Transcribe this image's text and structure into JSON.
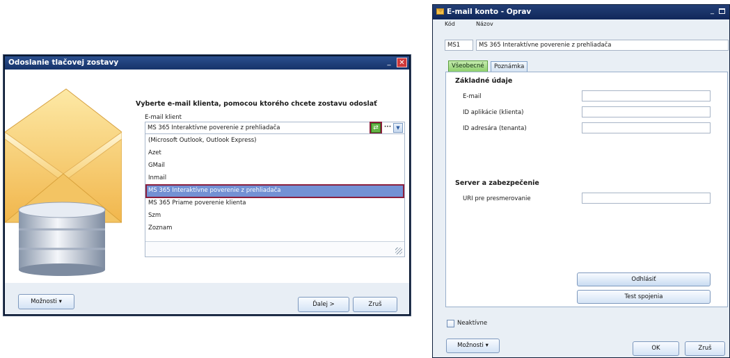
{
  "left_dialog": {
    "title": "Odoslanie tlačovej zostavy",
    "minimize_glyph": "_",
    "close_glyph": "✕",
    "heading": "Vyberte e-mail klienta, pomocou ktorého chcete zostavu odoslať",
    "field_label": "E-mail klient",
    "combo_value": "MS 365 Interaktívne poverenie z prehliadača",
    "combo_green_glyph": "⇄",
    "combo_dots": "···",
    "combo_down_glyph": "▼",
    "options": [
      "(Microsoft Outlook, Outlook Express)",
      "Azet",
      "GMail",
      "Inmail",
      "MS 365 Interaktívne poverenie z prehliadača",
      "MS 365 Priame poverenie klienta",
      "Szm",
      "Zoznam"
    ],
    "selected_option": "MS 365 Interaktívne poverenie z prehliadača",
    "buttons": {
      "moznosti": "Možnosti ▾",
      "dalej": "Ďalej >",
      "zrus": "Zruš"
    },
    "icons": [
      "envelope-icon",
      "database-icon"
    ]
  },
  "right_dialog": {
    "title": "E-mail konto - Oprav",
    "minimize_glyph": "_",
    "kod_label": "Kód",
    "nazov_label": "Názov",
    "kod_value": "MS1",
    "nazov_value": "MS 365 Interaktívne poverenie z prehliadača",
    "tabs": [
      "Všeobecné",
      "Poznámka"
    ],
    "active_tab": "Všeobecné",
    "section_basic": "Základné údaje",
    "fields": {
      "email": {
        "label": "E-mail",
        "value": ""
      },
      "app_id": {
        "label": "ID aplikácie (klienta)",
        "value": ""
      },
      "directory_id": {
        "label": "ID adresára (tenanta)",
        "value": ""
      }
    },
    "section_server": "Server a zabezpečenie",
    "redirect_uri": {
      "label": "URI pre presmerovanie",
      "value": ""
    },
    "buttons": {
      "odhlasit": "Odhlásiť",
      "test": "Test spojenia",
      "moznosti": "Možnosti ▾",
      "ok": "OK",
      "zrus": "Zruš"
    },
    "neaktivne_label": "Neaktívne",
    "neaktivne_checked": false
  },
  "colors": {
    "titlebar": "#1d3f7c",
    "selection": "#7391d4",
    "highlight_border": "#8b1e3c",
    "active_tab": "#8ecf6d"
  }
}
